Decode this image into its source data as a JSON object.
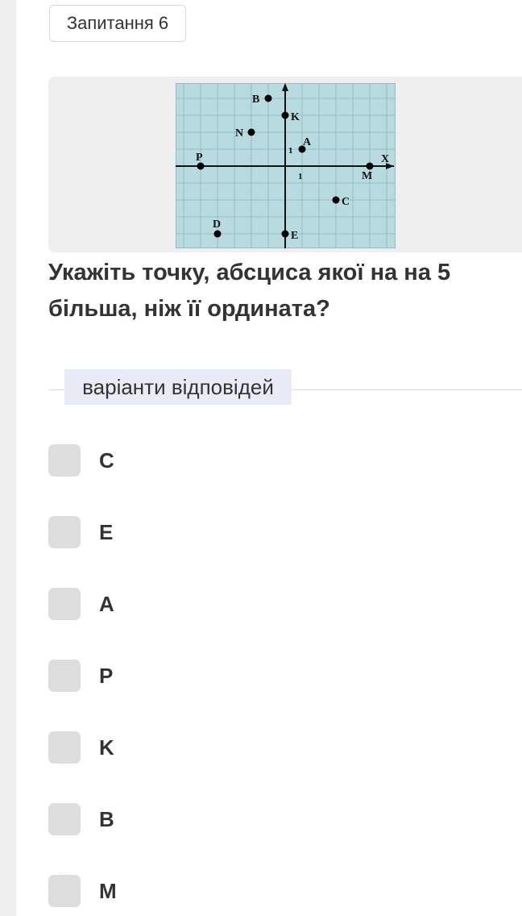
{
  "question_badge": "Запитання 6",
  "question_text": "Укажіть точку, абсциса якої на на 5 більша, ніж її ордината?",
  "answers_header": "варіанти відповідей",
  "options": [
    "C",
    "E",
    "A",
    "P",
    "K",
    "B",
    "M"
  ],
  "figure": {
    "axis_x_label": "X",
    "unit_label_x": "1",
    "unit_label_y": "1",
    "grid_color": "#8fb3c0",
    "background_color": "#b8dbe0",
    "points": [
      {
        "name": "B",
        "x": -1,
        "y": 4
      },
      {
        "name": "K",
        "x": 0,
        "y": 3
      },
      {
        "name": "N",
        "x": -2,
        "y": 2
      },
      {
        "name": "A",
        "x": 1,
        "y": 1
      },
      {
        "name": "P",
        "x": -5,
        "y": 0
      },
      {
        "name": "M",
        "x": 5,
        "y": 0
      },
      {
        "name": "C",
        "x": 3,
        "y": -2
      },
      {
        "name": "D",
        "x": -4,
        "y": -4
      },
      {
        "name": "E",
        "x": 0,
        "y": -4
      }
    ]
  }
}
